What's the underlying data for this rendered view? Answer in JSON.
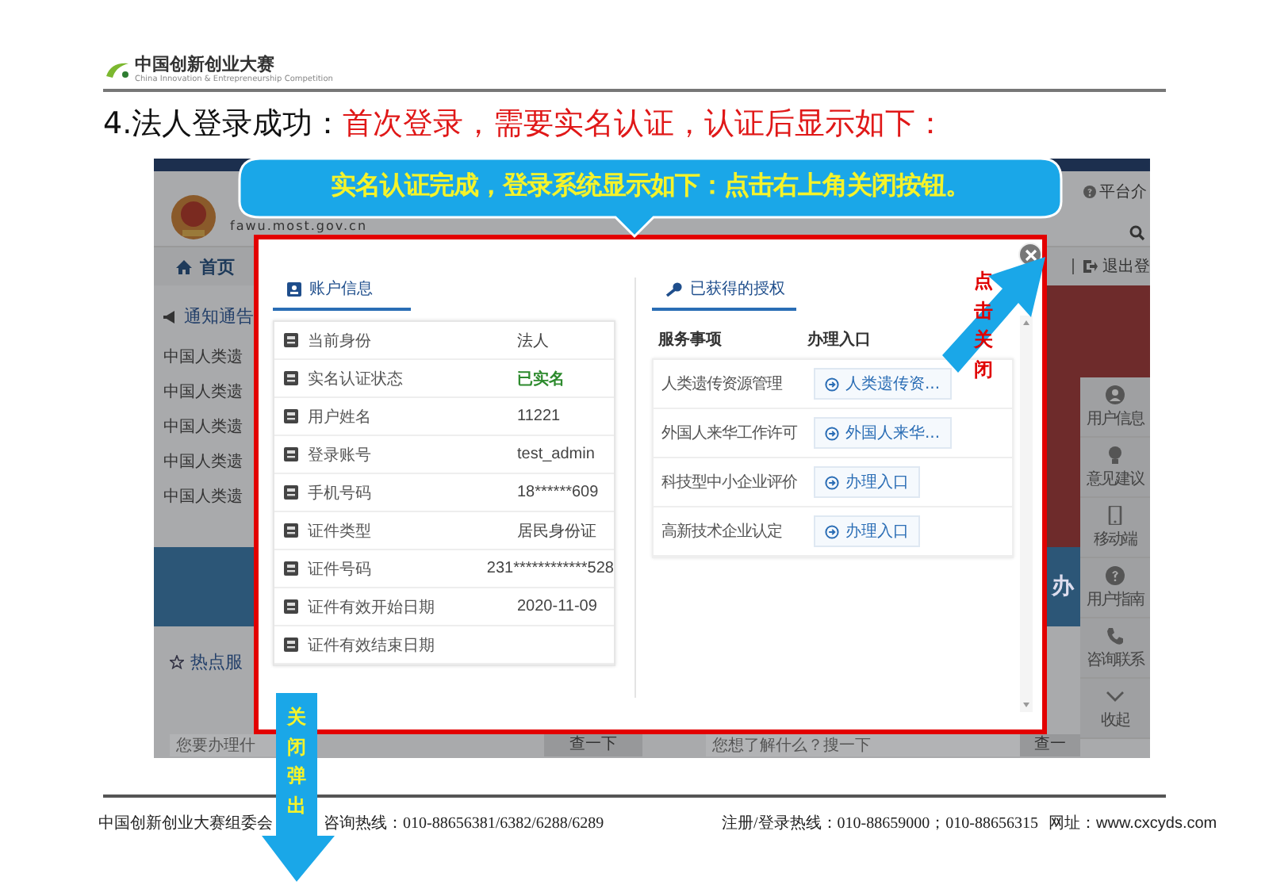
{
  "slide_header": {
    "logo_text": "中国创新创业大赛",
    "logo_subtitle": "China Innovation & Entrepreneurship Competition"
  },
  "title": {
    "lead": "4.法人登录成功：",
    "highlight": "首次登录，需要实名认证，认证后显示如下："
  },
  "callout": {
    "text": "实名认证完成，登录系统显示如下：点击右上角关闭按钮。"
  },
  "close_hint": "点击关闭",
  "dismiss_hint": "关闭弹出",
  "portal": {
    "site_url": "fawu.most.gov.cn",
    "top_link": "平台介",
    "home": "首页",
    "logout": "退出登",
    "notices": {
      "heading": "通知通告",
      "items": [
        "中国人类遗",
        "中国人类遗",
        "中国人类遗",
        "中国人类遗",
        "中国人类遗"
      ]
    },
    "banner_text": "办",
    "hot_services": "热点服",
    "searches": [
      {
        "placeholder": "您要办理什",
        "button": "查一下"
      },
      {
        "placeholder": "您想了解什么？搜一下",
        "button": "查一"
      }
    ],
    "side_tools": [
      "用户信息",
      "意见建议",
      "移动端",
      "用户指南",
      "咨询联系",
      "收起"
    ]
  },
  "dialog": {
    "account_tab": "账户信息",
    "account_rows": [
      {
        "label": "当前身份",
        "value": "法人",
        "verified": false
      },
      {
        "label": "实名认证状态",
        "value": "已实名",
        "verified": true
      },
      {
        "label": "用户姓名",
        "value": "11221",
        "verified": false
      },
      {
        "label": "登录账号",
        "value": "test_admin",
        "verified": false
      },
      {
        "label": "手机号码",
        "value": "18******609",
        "verified": false
      },
      {
        "label": "证件类型",
        "value": "居民身份证",
        "verified": false
      },
      {
        "label": "证件号码",
        "value": "231************528",
        "verified": false
      },
      {
        "label": "证件有效开始日期",
        "value": "2020-11-09",
        "verified": false
      },
      {
        "label": "证件有效结束日期"
      }
    ],
    "grants_tab": "已获得的授权",
    "grant_columns": [
      "服务事项",
      "办理入口"
    ],
    "grants": [
      {
        "name": "人类遗传资源管理",
        "action": "人类遗传资..."
      },
      {
        "name": "外国人来华工作许可",
        "action": "外国人来华..."
      },
      {
        "name": "科技型中小企业评价",
        "action": "办理入口"
      },
      {
        "name": "高新技术企业认定",
        "action": "办理入口"
      }
    ]
  },
  "footer": [
    "中国创新创业大赛组委会",
    "咨询热线：010-88656381/6382/6288/6289",
    "注册/登录热线：010-88659000；010-88656315",
    "网址：www.cxcyds.com"
  ]
}
